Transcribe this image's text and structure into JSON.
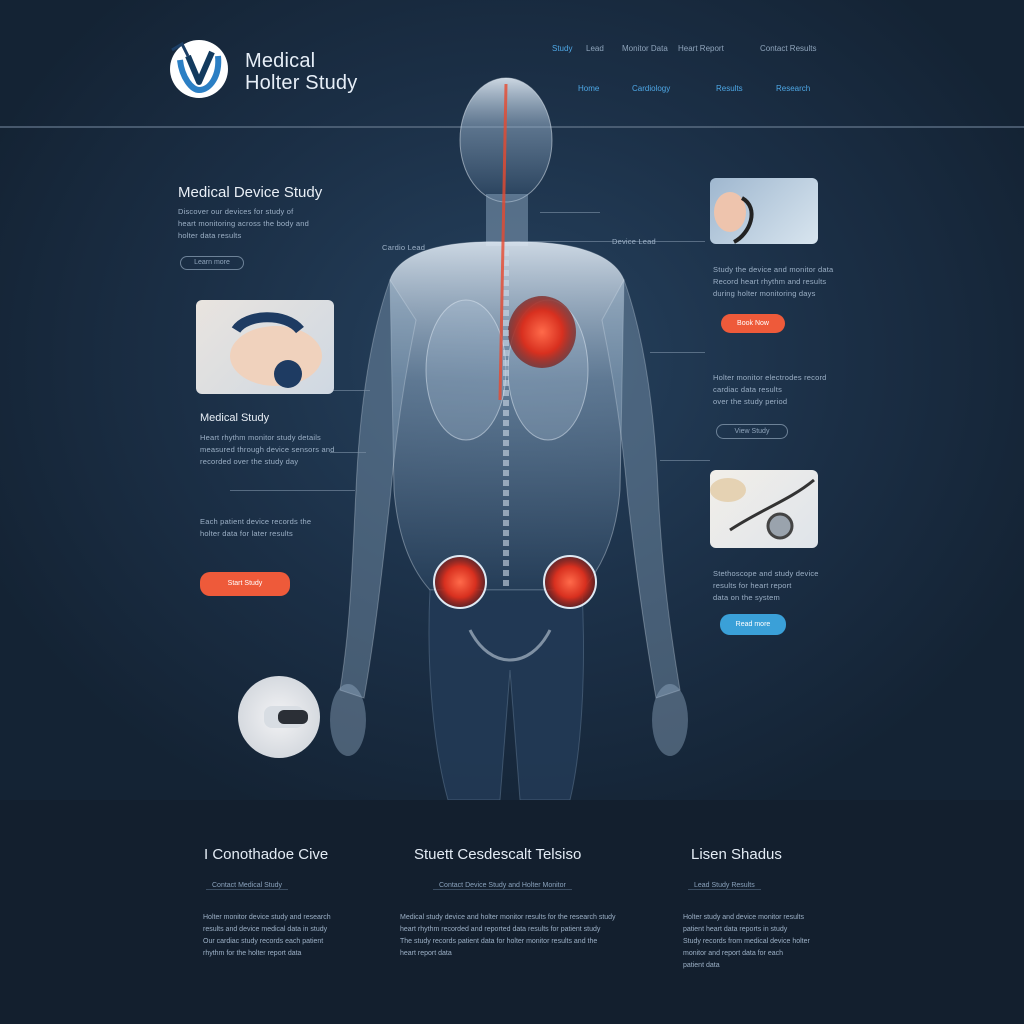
{
  "header": {
    "brand_line1": "Medical",
    "brand_line2": "Holter Study",
    "nav_top": [
      "Study",
      "Lead",
      "Monitor Data",
      "Heart Report",
      "Contact Results"
    ],
    "nav_bottom": [
      "Home",
      "Cardiology",
      "Results",
      "Research"
    ]
  },
  "left": {
    "section1_title": "Medical Device Study",
    "section1_lines": [
      "Discover our devices for study of",
      "heart monitoring across the body and",
      "holter data results"
    ],
    "section1_button": "Learn more",
    "label_top": "Cardio Lead",
    "section2_title": "Medical Study",
    "section2_lines": [
      "Heart rhythm monitor study details",
      "measured through device sensors and",
      "recorded over the study day"
    ],
    "section3_lines": [
      "Each patient device records the",
      "holter data for later results"
    ],
    "section3_button": "Start Study"
  },
  "right": {
    "label_top": "Device Lead",
    "block1_lines": [
      "Study the device and monitor data",
      "Record heart rhythm and results",
      "during holter monitoring days"
    ],
    "block1_button": "Book Now",
    "block2_lines": [
      "Holter monitor electrodes record",
      "cardiac data results",
      "over the study period"
    ],
    "block2_button": "View Study",
    "block3_lines": [
      "Stethoscope and study device",
      "results for heart report",
      "data on the system"
    ],
    "block3_button": "Read more"
  },
  "footer": {
    "columns": [
      {
        "title": "I Conothadoe Cive",
        "sub": "Contact Medical Study",
        "lines": [
          "Holter monitor device study and research",
          "results and device medical data in study",
          "",
          "Our cardiac study records each patient",
          "rhythm for the holter report data"
        ]
      },
      {
        "title": "Stuett Cesdescalt Telsiso",
        "sub": "Contact Device Study and Holter Monitor",
        "lines": [
          "Medical study device and holter monitor results for the research study",
          "heart rhythm recorded and reported data results for patient study",
          "",
          "The study records patient data for holter monitor results and the",
          "heart report data"
        ]
      },
      {
        "title": "Lisen Shadus",
        "sub": "Lead Study Results",
        "lines": [
          "Holter study and device monitor results",
          "patient heart data reports in study",
          "",
          "Study records from medical device holter",
          "monitor and report data for each",
          "patient data"
        ]
      }
    ]
  },
  "colors": {
    "accent_orange": "#ee5a3a",
    "accent_blue": "#3aa0d8",
    "background": "#1b2f46"
  }
}
